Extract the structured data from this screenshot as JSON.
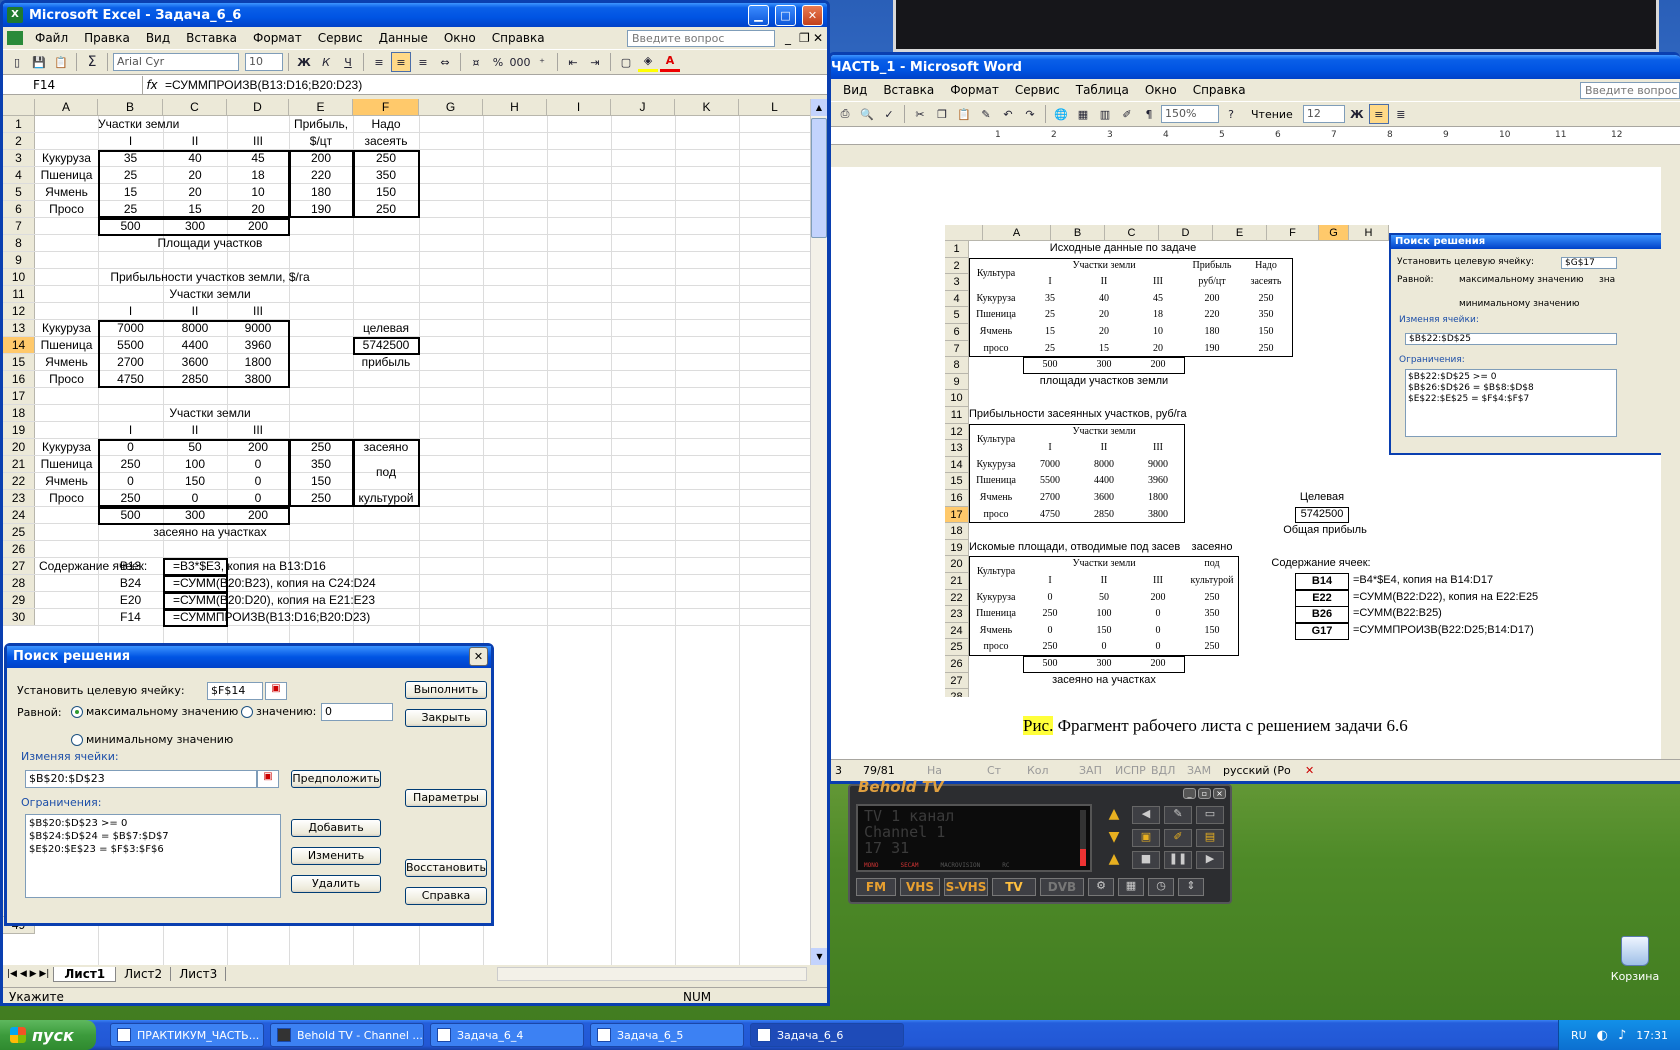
{
  "excel": {
    "title": "Microsoft Excel - Задача_6_6",
    "menu": [
      "Файл",
      "Правка",
      "Вид",
      "Вставка",
      "Формат",
      "Сервис",
      "Данные",
      "Окно",
      "Справка"
    ],
    "ask_placeholder": "Введите вопрос",
    "font": "Arial Cyr",
    "font_size": "10",
    "cell_ref": "F14",
    "formula": "=СУММПРОИЗВ(B13:D16;B20:D23)",
    "columns": [
      "A",
      "B",
      "C",
      "D",
      "E",
      "F",
      "G",
      "H",
      "I",
      "J",
      "K",
      "L"
    ],
    "rows_top": [
      "1",
      "2",
      "3",
      "4",
      "5",
      "6",
      "7",
      "8",
      "9",
      "10",
      "11",
      "12",
      "13",
      "14",
      "15",
      "16",
      "17",
      "18",
      "19",
      "20",
      "21",
      "22",
      "23",
      "24",
      "25",
      "26",
      "27",
      "28",
      "29",
      "30"
    ],
    "rows_bottom": [
      "48",
      "49"
    ],
    "sheets": [
      "Лист1",
      "Лист2",
      "Лист3"
    ],
    "status_left": "Укажите",
    "status_num": "NUM",
    "cells": {
      "b1": "Участки земли",
      "e1": "Прибыль,",
      "f1": "Надо",
      "b2": "I",
      "c2": "II",
      "d2": "III",
      "e2": "$/цт",
      "f2": "засеять",
      "a3": "Кукуруза",
      "b3": "35",
      "c3": "40",
      "d3": "45",
      "e3": "200",
      "f3": "250",
      "a4": "Пшеница",
      "b4": "25",
      "c4": "20",
      "d4": "18",
      "e4": "220",
      "f4": "350",
      "a5": "Ячмень",
      "b5": "15",
      "c5": "20",
      "d5": "10",
      "e5": "180",
      "f5": "150",
      "a6": "Просо",
      "b6": "25",
      "c6": "15",
      "d6": "20",
      "e6": "190",
      "f6": "250",
      "b7": "500",
      "c7": "300",
      "d7": "200",
      "t8": "Площади участков",
      "t10": "Прибыльности участков земли, $/га",
      "t11": "Участки земли",
      "b12": "I",
      "c12": "II",
      "d12": "III",
      "a13": "Кукуруза",
      "b13": "7000",
      "c13": "8000",
      "d13": "9000",
      "f13": "целевая",
      "a14": "Пшеница",
      "b14": "5500",
      "c14": "4400",
      "d14": "3960",
      "f14": "5742500",
      "a15": "Ячмень",
      "b15": "2700",
      "c15": "3600",
      "d15": "1800",
      "f15": "прибыль",
      "a16": "Просо",
      "b16": "4750",
      "c16": "2850",
      "d16": "3800",
      "t18": "Участки земли",
      "b19": "I",
      "c19": "II",
      "d19": "III",
      "a20": "Кукуруза",
      "b20": "0",
      "c20": "50",
      "d20": "200",
      "e20": "250",
      "f20": "засеяно",
      "a21": "Пшеница",
      "b21": "250",
      "c21": "100",
      "d21": "0",
      "e21": "350",
      "f21": "под",
      "a22": "Ячмень",
      "b22": "0",
      "c22": "150",
      "d22": "0",
      "e22": "150",
      "a23": "Просо",
      "b23": "250",
      "c23": "0",
      "d23": "0",
      "e23": "250",
      "f23": "культурой",
      "b24": "500",
      "c24": "300",
      "d24": "200",
      "t25": "засеяно на участках",
      "a27": "Содержание ячеек:",
      "b27": "B13",
      "c27": "=B3*$E3, копия на B13:D16",
      "b28": "B24",
      "c28": "=СУММ(B20:B23), копия на C24:D24",
      "b29": "E20",
      "c29": "=СУММ(B20:D20), копия на E21:E23",
      "b30": "F14",
      "c30": "=СУММПРОИЗВ(B13:D16;B20:D23)"
    }
  },
  "solver": {
    "title": "Поиск решения",
    "target_label": "Установить целевую ячейку:",
    "target_value": "$F$14",
    "equal_label": "Равной:",
    "opt_max": "максимальному значению",
    "opt_value": "значению:",
    "value_field": "0",
    "opt_min": "минимальному значению",
    "changing_label": "Изменяя ячейки:",
    "changing_value": "$B$20:$D$23",
    "constraints_label": "Ограничения:",
    "constraints": [
      "$B$20:$D$23 >= 0",
      "$B$24:$D$24 = $B$7:$D$7",
      "$E$20:$E$23 = $F$3:$F$6"
    ],
    "buttons": {
      "run": "Выполнить",
      "close": "Закрыть",
      "guess": "Предположить",
      "options": "Параметры",
      "add": "Добавить",
      "change": "Изменить",
      "delete": "Удалить",
      "reset": "Восстановить",
      "help": "Справка"
    }
  },
  "word": {
    "title": "ЧАСТЬ_1 - Microsoft Word",
    "menu": [
      "Вид",
      "Вставка",
      "Формат",
      "Сервис",
      "Таблица",
      "Окно",
      "Справка"
    ],
    "ask_placeholder": "Введите вопрос",
    "zoom": "150%",
    "read_label": "Чтение",
    "font_size": "12",
    "ruler": [
      "1",
      "2",
      "3",
      "4",
      "5",
      "6",
      "7",
      "8",
      "9",
      "10",
      "11",
      "12"
    ],
    "status": [
      "3",
      "79/81",
      "На",
      "Ст",
      "Кол",
      "ЗАП",
      "ИСПР",
      "ВДЛ",
      "ЗАМ",
      "русский (Ро"
    ],
    "caption_prefix": "Рис.",
    "caption": "Фрагмент рабочего листа с решением задачи 6.6",
    "sheet": {
      "cols": [
        "A",
        "B",
        "C",
        "D",
        "E",
        "F",
        "G",
        "H"
      ],
      "rows": [
        "1",
        "2",
        "3",
        "4",
        "5",
        "6",
        "7",
        "8",
        "9",
        "10",
        "11",
        "12",
        "13",
        "14",
        "15",
        "16",
        "17",
        "18",
        "19",
        "20",
        "21",
        "22",
        "23",
        "24",
        "25",
        "26",
        "27",
        "28"
      ],
      "r1": "Исходные данные по задаче",
      "culture": "Культура",
      "plots": "Участки земли",
      "profit1": "Прибыль",
      "profit2": "руб/цт",
      "need1": "Надо",
      "need2": "засеять",
      "roman": [
        "I",
        "II",
        "III"
      ],
      "data_rows": [
        [
          "Кукуруза",
          "35",
          "40",
          "45",
          "200",
          "250"
        ],
        [
          "Пшеница",
          "25",
          "20",
          "18",
          "220",
          "350"
        ],
        [
          "Ячмень",
          "15",
          "20",
          "10",
          "180",
          "150"
        ],
        [
          "просо",
          "25",
          "15",
          "20",
          "190",
          "250"
        ]
      ],
      "totals": [
        "500",
        "300",
        "200"
      ],
      "r9": "площади участков земли",
      "r11": "Прибыльности засеянных участков, руб/га",
      "profit_rows": [
        [
          "Кукуруза",
          "7000",
          "8000",
          "9000"
        ],
        [
          "Пшеница",
          "5500",
          "4400",
          "3960"
        ],
        [
          "Ячмень",
          "2700",
          "3600",
          "1800"
        ],
        [
          "просо",
          "4750",
          "2850",
          "3800"
        ]
      ],
      "target_label": "Целевая",
      "target_value": "5742500",
      "target_label2": "Общая прибыль",
      "r19": "Искомые площади, отводимые под засев",
      "sown": "засеяно",
      "under": "под",
      "crop": "культурой",
      "area_rows": [
        [
          "Кукуруза",
          "0",
          "50",
          "200",
          "250"
        ],
        [
          "Пшеница",
          "250",
          "100",
          "0",
          "350"
        ],
        [
          "Ячмень",
          "0",
          "150",
          "0",
          "150"
        ],
        [
          "просо",
          "250",
          "0",
          "0",
          "250"
        ]
      ],
      "r27": "засеяно на участках",
      "contents_label": "Содержание ячеек:",
      "contents": [
        [
          "B14",
          "=B4*$E4, копия на B14:D17"
        ],
        [
          "E22",
          "=СУММ(B22:D22), копия на E22:E25"
        ],
        [
          "B26",
          "=СУММ(B22:B25)"
        ],
        [
          "G17",
          "=СУММПРОИЗВ(B22:D25;B14:D17)"
        ]
      ],
      "solver_title": "Поиск решения",
      "solver_target_label": "Установить целевую ячейку:",
      "solver_target": "$G$17",
      "solver_equal": "Равной:",
      "solver_max": "максимальному значению",
      "solver_val": "зна",
      "solver_min": "минимальному значению",
      "solver_change_label": "Изменяя ячейки:",
      "solver_change": "$B$22:$D$25",
      "solver_constr_label": "Ограничения:",
      "solver_constr": [
        "$B$22:$D$25 >= 0",
        "$B$26:$D$26 = $B$8:$D$8",
        "$E$22:$E$25 = $F$4:$F$7"
      ]
    }
  },
  "tv": {
    "title": "Behold TV",
    "line1": "TV 1 канал",
    "line2": "Channel 1",
    "line3": "17 31",
    "btns": [
      "FM",
      "VHS",
      "S-VHS",
      "TV",
      "DVB"
    ],
    "marks": [
      "MONO",
      "SECAM",
      "MACROVISION",
      "RC"
    ]
  },
  "desktop": {
    "recycle": "Корзина"
  },
  "taskbar": {
    "start": "пуск",
    "tasks": [
      "ПРАКТИКУМ_ЧАСТЬ...",
      "Behold TV - Channel ...",
      "Задача_6_4",
      "Задача_6_5",
      "Задача_6_6"
    ],
    "lang": "RU",
    "time": "17:31"
  }
}
